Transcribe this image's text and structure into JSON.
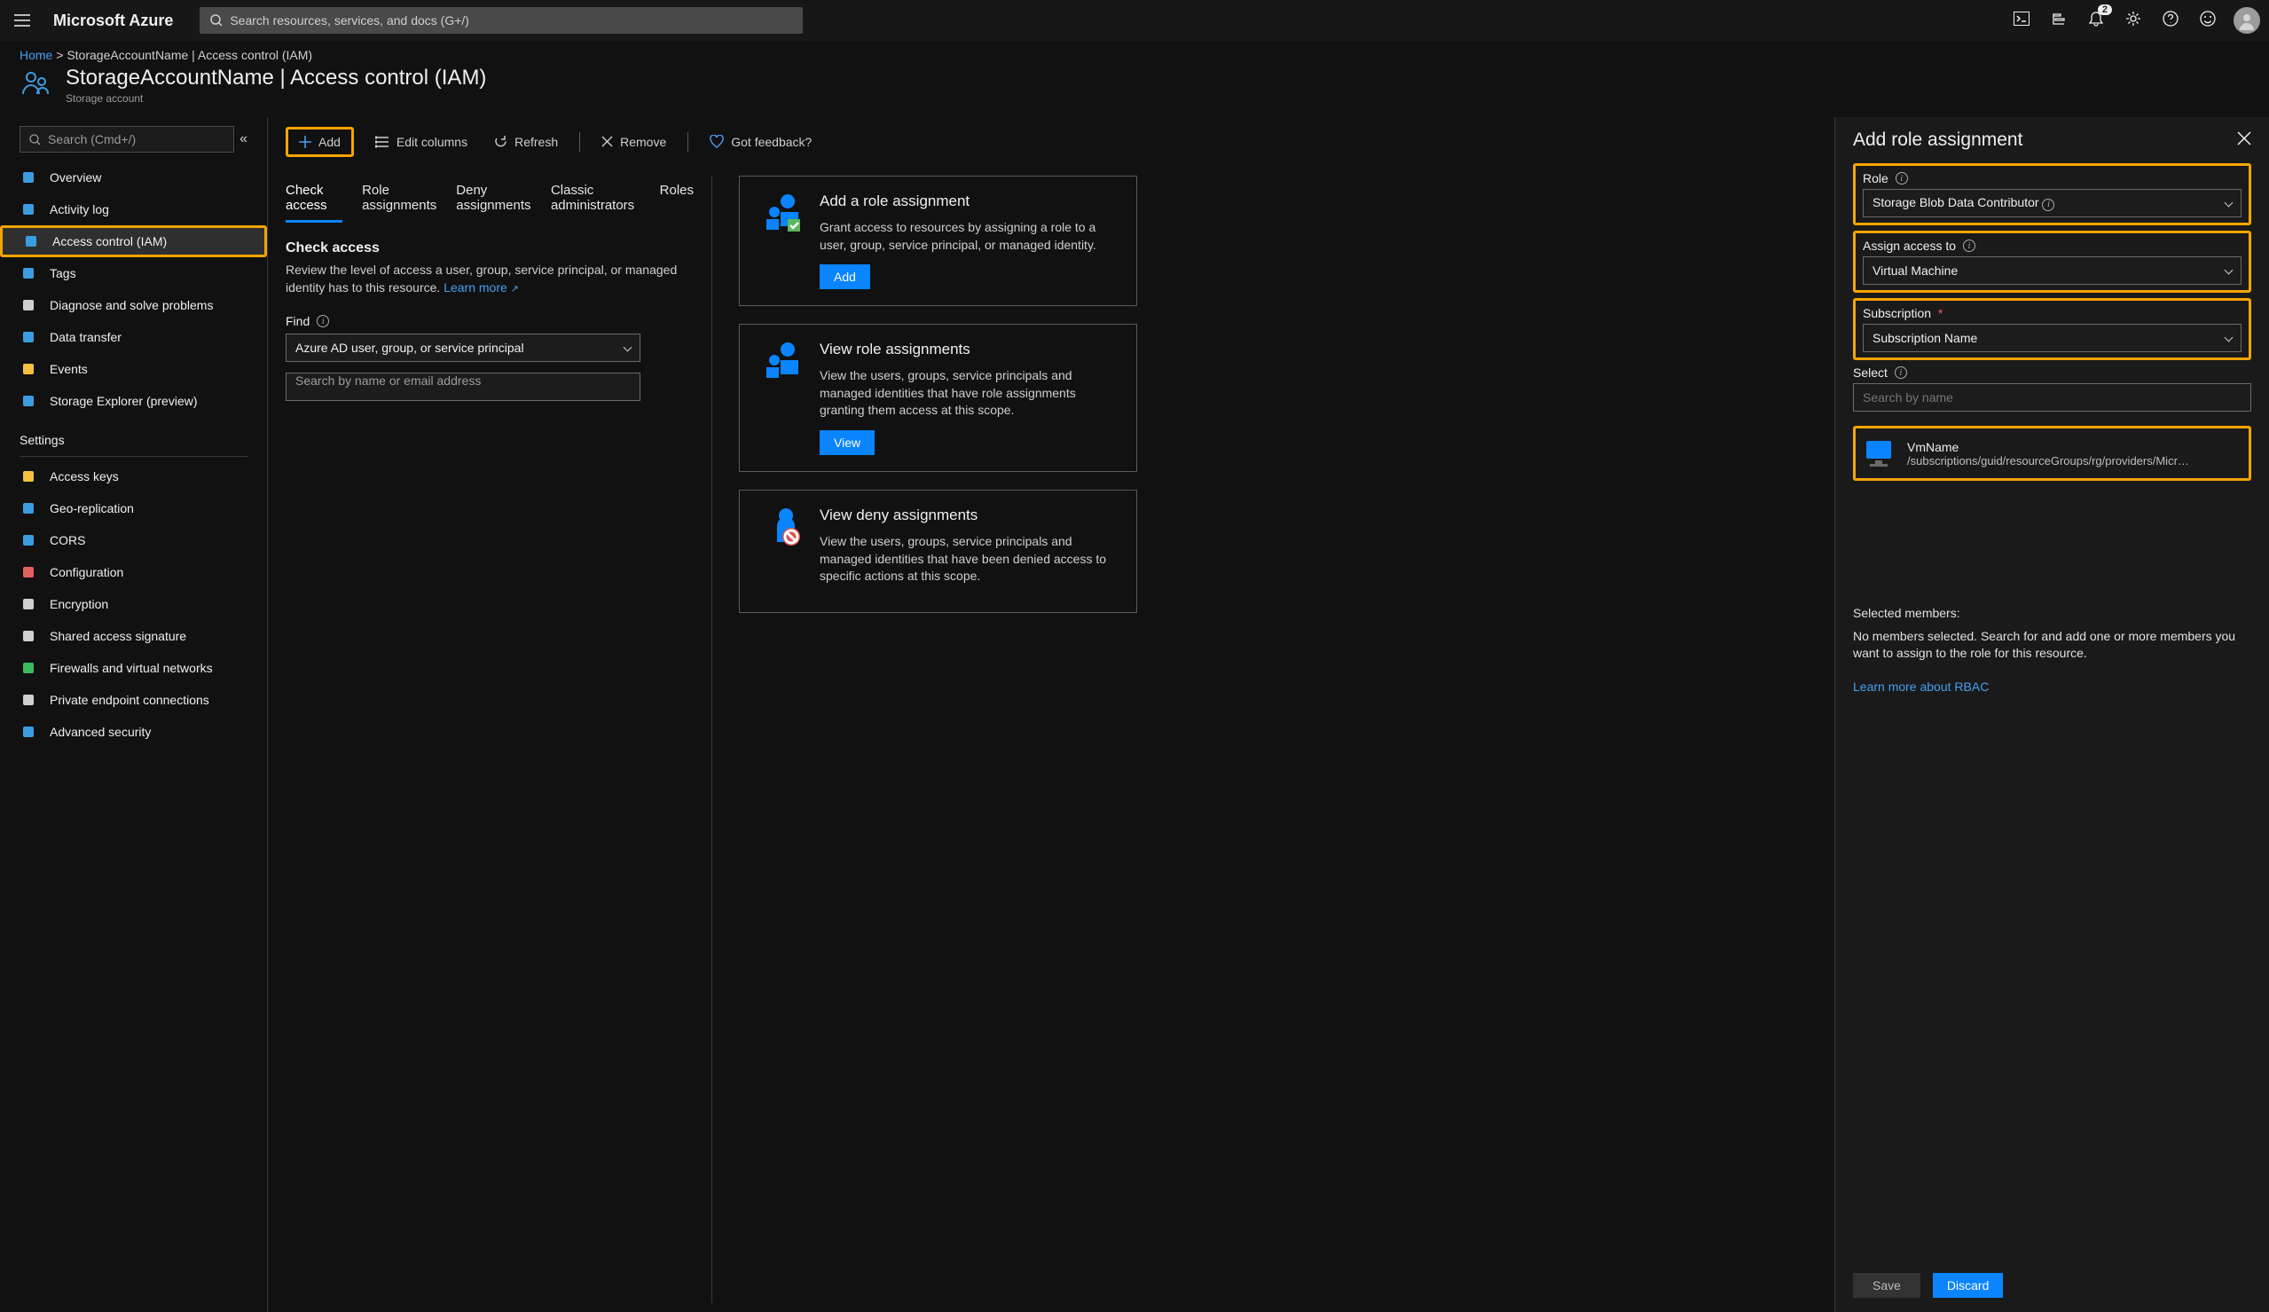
{
  "top": {
    "brand": "Microsoft Azure",
    "search_placeholder": "Search resources, services, and docs (G+/)",
    "notif_count": "2"
  },
  "breadcrumb": {
    "home": "Home",
    "sep": " > ",
    "tail": "StorageAccountName | Access control (IAM)"
  },
  "header": {
    "title": "StorageAccountName | Access control (IAM)",
    "subtitle": "Storage account"
  },
  "sidebar": {
    "search_placeholder": "Search (Cmd+/)",
    "items": [
      {
        "label": "Overview",
        "color": "#3c9ce0"
      },
      {
        "label": "Activity log",
        "color": "#3c9ce0"
      },
      {
        "label": "Access control (IAM)",
        "color": "#3c9ce0",
        "active": true,
        "highlight": true
      },
      {
        "label": "Tags",
        "color": "#3c9ce0"
      },
      {
        "label": "Diagnose and solve problems",
        "color": "#cfcfcf"
      },
      {
        "label": "Data transfer",
        "color": "#3c9ce0"
      },
      {
        "label": "Events",
        "color": "#f5c040"
      },
      {
        "label": "Storage Explorer (preview)",
        "color": "#3c9ce0"
      }
    ],
    "settings_label": "Settings",
    "settings": [
      {
        "label": "Access keys",
        "color": "#f5c040"
      },
      {
        "label": "Geo-replication",
        "color": "#3c9ce0"
      },
      {
        "label": "CORS",
        "color": "#3c9ce0"
      },
      {
        "label": "Configuration",
        "color": "#e06060"
      },
      {
        "label": "Encryption",
        "color": "#cfcfcf"
      },
      {
        "label": "Shared access signature",
        "color": "#cfcfcf"
      },
      {
        "label": "Firewalls and virtual networks",
        "color": "#3cba5b"
      },
      {
        "label": "Private endpoint connections",
        "color": "#cfcfcf"
      },
      {
        "label": "Advanced security",
        "color": "#3c9ce0"
      }
    ]
  },
  "toolbar": {
    "add": "Add",
    "edit_columns": "Edit columns",
    "refresh": "Refresh",
    "remove": "Remove",
    "feedback": "Got feedback?"
  },
  "tabs": [
    "Check access",
    "Role assignments",
    "Deny assignments",
    "Classic administrators",
    "Roles"
  ],
  "check": {
    "heading": "Check access",
    "desc": "Review the level of access a user, group, service principal, or managed identity has to this resource. ",
    "learn_more": "Learn more",
    "find_label": "Find",
    "find_value": "Azure AD user, group, or service principal",
    "search_placeholder": "Search by name or email address"
  },
  "cards": {
    "add": {
      "title": "Add a role assignment",
      "desc": "Grant access to resources by assigning a role to a user, group, service principal, or managed identity.",
      "btn": "Add"
    },
    "view": {
      "title": "View role assignments",
      "desc": "View the users, groups, service principals and managed identities that have role assignments granting them access at this scope.",
      "btn": "View"
    },
    "deny": {
      "title": "View deny assignments",
      "desc": "View the users, groups, service principals and managed identities that have been denied access to specific actions at this scope."
    }
  },
  "panel": {
    "title": "Add role assignment",
    "role_label": "Role",
    "role_value": "Storage Blob Data Contributor",
    "assign_label": "Assign access to",
    "assign_value": "Virtual Machine",
    "sub_label": "Subscription",
    "sub_value": "Subscription Name",
    "select_label": "Select",
    "select_placeholder": "Search by name",
    "member_name": "VmName",
    "member_path": "/subscriptions/guid/resourceGroups/rg/providers/Micr…",
    "selected_heading": "Selected members:",
    "none_msg": "No members selected. Search for and add one or more members you want to assign to the role for this resource.",
    "rbac_link": "Learn more about RBAC",
    "save": "Save",
    "discard": "Discard"
  }
}
